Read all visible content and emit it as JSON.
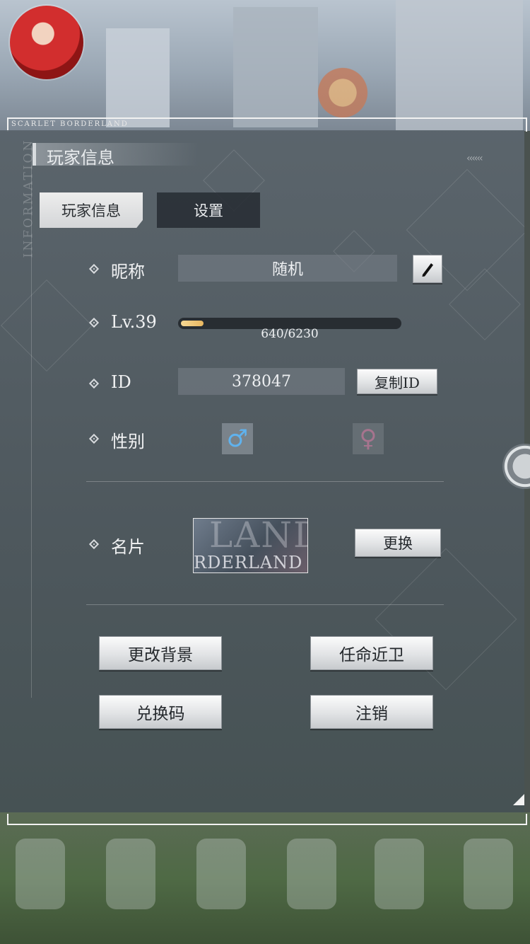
{
  "brand": {
    "strip_text": "SCARLET BORDERLAND",
    "vertical_text": "INFORMATION"
  },
  "header": {
    "title": "玩家信息"
  },
  "tabs": [
    {
      "label": "玩家信息",
      "active": true
    },
    {
      "label": "设置",
      "active": false
    }
  ],
  "profile": {
    "nickname_label": "昵称",
    "nickname_value": "随机",
    "level_label": "Lv.39",
    "xp_current": 640,
    "xp_max": 6230,
    "xp_text": "640/6230",
    "id_label": "ID",
    "id_value": "378047",
    "copy_id_label": "复制ID",
    "gender_label": "性别",
    "gender_selected": "male",
    "male_symbol": "♂",
    "female_symbol": "♀",
    "card_label": "名片",
    "card_text_large": "LAND",
    "card_text_small": "RDERLAND",
    "change_card_label": "更换"
  },
  "actions": {
    "change_background": "更改背景",
    "appoint_guard": "任命近卫",
    "redeem_code": "兑换码",
    "logout": "注销"
  },
  "icons": {
    "edit": "pencil-icon",
    "scroll": "dial-icon",
    "chevrons": "‹‹‹‹‹‹"
  },
  "colors": {
    "xp_fill": "#f0c878",
    "male": "#5fb2ee",
    "female": "#d278a0",
    "tab_active_bg": "#e4e6e8"
  }
}
